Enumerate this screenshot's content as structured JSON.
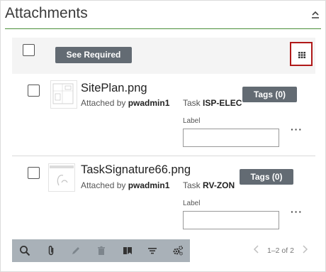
{
  "header": {
    "title": "Attachments",
    "collapse_icon": "chevron-up-icon"
  },
  "toolbar": {
    "see_required_label": "See Required",
    "grid_icon": "grid-icon",
    "accent": "#b01919"
  },
  "items": [
    {
      "name": "SitePlan.png",
      "attached_by_prefix": "Attached by",
      "attached_by": "pwadmin1",
      "task_prefix": "Task",
      "task": "ISP-ELEC",
      "tags_label": "Tags (0)",
      "label_caption": "Label",
      "label_value": "",
      "more": "···"
    },
    {
      "name": "TaskSignature66.png",
      "attached_by_prefix": "Attached by",
      "attached_by": "pwadmin1",
      "task_prefix": "Task",
      "task": "RV-ZON",
      "tags_label": "Tags (0)",
      "label_caption": "Label",
      "label_value": "",
      "more": "···"
    }
  ],
  "bottom_bar": {
    "icons": [
      "search-icon",
      "paperclip-icon",
      "pencil-icon",
      "trash-icon",
      "bookmark-icon",
      "filter-icon",
      "gear-icon"
    ]
  },
  "pager": {
    "text": "1–2 of 2"
  }
}
